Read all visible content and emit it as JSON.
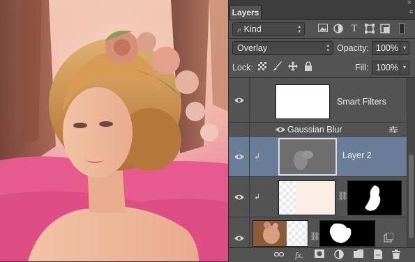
{
  "panel": {
    "tab_label": "Layers",
    "close_glyph": "×",
    "menu_glyph": "≡",
    "filter": {
      "kind_label": "Kind",
      "search_icon": "⌕",
      "filter_icons": [
        "image-icon",
        "adjustment-icon",
        "type-icon",
        "shape-icon",
        "smart-object-icon"
      ]
    },
    "blend_mode": "Overlay",
    "opacity_label": "Opacity:",
    "opacity_value": "100%",
    "lock_label": "Lock:",
    "fill_label": "Fill:",
    "fill_value": "100%"
  },
  "layers": [
    {
      "type": "smart-filters",
      "name": "Smart Filters",
      "visible": true
    },
    {
      "type": "filter",
      "name": "Gaussian Blur",
      "visible": true
    },
    {
      "type": "layer",
      "name": "Layer 2",
      "visible": true,
      "selected": true,
      "clipped": true
    },
    {
      "type": "masked-layer",
      "name": "",
      "visible": true,
      "clipped": true,
      "linked": true
    },
    {
      "type": "masked-layer",
      "name": "",
      "visible": true,
      "linked": true,
      "smart": true
    }
  ],
  "footer_icons": [
    "link-layers-icon",
    "fx-icon",
    "add-mask-icon",
    "adjustment-layer-icon",
    "group-icon",
    "new-layer-icon",
    "trash-icon"
  ],
  "glyphs": {
    "fx": "fx.",
    "chain": "⛓",
    "clip_arrow": "↲",
    "dropdown": "▾",
    "select_arrows": "▴▾"
  },
  "colors": {
    "panel_bg": "#535353",
    "selected_row": "#6a7d98",
    "canvas_pink": "#e0588a"
  }
}
